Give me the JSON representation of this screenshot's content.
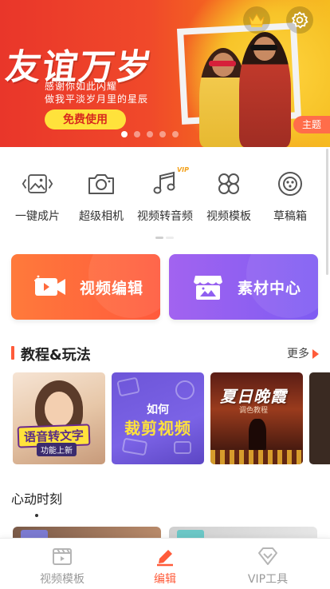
{
  "banner": {
    "title": "友谊万岁",
    "subtitle_line1": "感谢你如此闪耀",
    "subtitle_line2": "做我平淡岁月里的星辰",
    "cta_label": "免费使用",
    "theme_tag": "主题",
    "slides_total": 5,
    "active_slide": 1
  },
  "tools": [
    {
      "label": "一键成片",
      "icon": "image-sparkle-icon"
    },
    {
      "label": "超级相机",
      "icon": "camera-icon"
    },
    {
      "label": "视频转音频",
      "icon": "music-note-icon",
      "badge": "VIP"
    },
    {
      "label": "视频模板",
      "icon": "template-grid-icon"
    },
    {
      "label": "草稿箱",
      "icon": "drafts-icon"
    }
  ],
  "cards": {
    "edit_label": "视频编辑",
    "material_label": "素材中心"
  },
  "tutorials": {
    "title": "教程&玩法",
    "more_label": "更多",
    "items": [
      {
        "caption": "语音转文字",
        "tag": "功能上新"
      },
      {
        "line1": "如何",
        "line2": "裁剪视频"
      },
      {
        "line1": "夏日晚霞",
        "line2": "调色教程"
      }
    ]
  },
  "moments": {
    "title": "心动时刻"
  },
  "bottom_nav": [
    {
      "label": "视频模板",
      "icon": "video-template-icon",
      "active": false
    },
    {
      "label": "编辑",
      "icon": "edit-icon",
      "active": true
    },
    {
      "label": "VIP工具",
      "icon": "vip-diamond-icon",
      "active": false
    }
  ],
  "colors": {
    "accent": "#ff5b3a",
    "edit_card": "#ff6a3c",
    "material_card": "#8f5ff1",
    "cta_yellow": "#ffe23b"
  }
}
